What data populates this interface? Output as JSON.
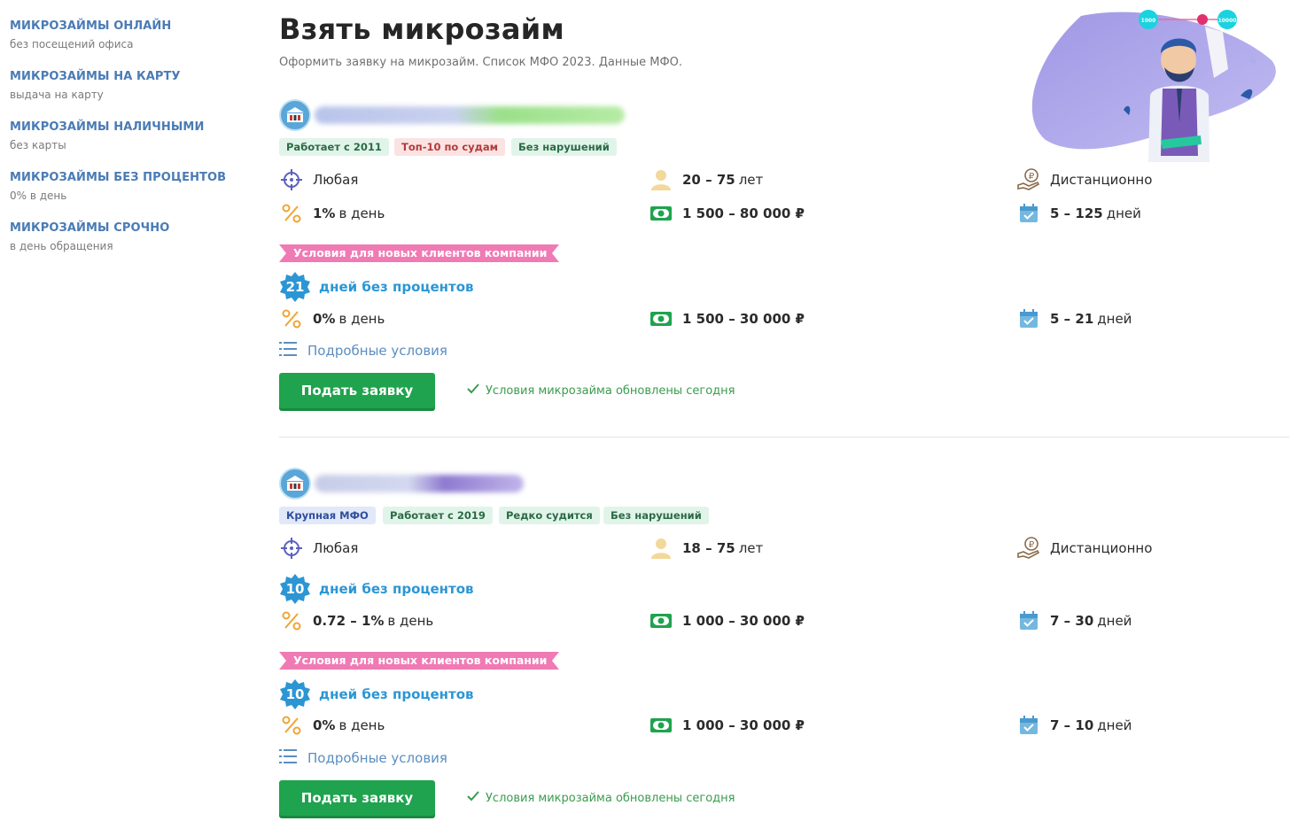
{
  "sidebar": {
    "items": [
      {
        "title": "МИКРОЗАЙМЫ ОНЛАЙН",
        "sub": "без посещений офиса"
      },
      {
        "title": "МИКРОЗАЙМЫ НА КАРТУ",
        "sub": "выдача на карту"
      },
      {
        "title": "МИКРОЗАЙМЫ НАЛИЧНЫМИ",
        "sub": "без карты"
      },
      {
        "title": "МИКРОЗАЙМЫ БЕЗ ПРОЦЕНТОВ",
        "sub": "0% в день"
      },
      {
        "title": "МИКРОЗАЙМЫ СРОЧНО",
        "sub": "в день обращения"
      }
    ]
  },
  "header": {
    "title": "Взять микрозайм",
    "subtitle": "Оформить заявку на микрозайм. Список МФО 2023. Данные МФО."
  },
  "illustration": {
    "coin_labels": [
      "1000",
      "10000"
    ]
  },
  "offers": [
    {
      "badges": [
        "Работает с 2011",
        "Топ-10 по судам",
        "Без нарушений"
      ],
      "history": "Любая",
      "age_value": "20 – 75",
      "age_unit": "лет",
      "method": "Дистанционно",
      "rate_value": "1%",
      "rate_unit": "в день",
      "amount": "1 500 – 80 000 ₽",
      "term_value": "5 – 125",
      "term_unit": "дней",
      "promo_label": "Условия для новых клиентов компании",
      "promo_days": "21",
      "promo_days_label": "дней без процентов",
      "promo_rate_value": "0%",
      "promo_rate_unit": "в день",
      "promo_amount": "1 500 – 30 000 ₽",
      "promo_term_value": "5 – 21",
      "promo_term_unit": "дней",
      "details_label": "Подробные условия",
      "apply_label": "Подать заявку",
      "updated_label": "Условия микрозайма обновлены сегодня"
    },
    {
      "badges": [
        "Крупная МФО",
        "Работает с 2019",
        "Редко судится",
        "Без нарушений"
      ],
      "history": "Любая",
      "age_value": "18 – 75",
      "age_unit": "лет",
      "method": "Дистанционно",
      "free_days": "10",
      "free_days_label": "дней без процентов",
      "rate_value": "0.72 – 1%",
      "rate_unit": "в день",
      "amount": "1 000 – 30 000 ₽",
      "term_value": "7 – 30",
      "term_unit": "дней",
      "promo_label": "Условия для новых клиентов компании",
      "promo_days": "10",
      "promo_days_label": "дней без процентов",
      "promo_rate_value": "0%",
      "promo_rate_unit": "в день",
      "promo_amount": "1 000 – 30 000 ₽",
      "promo_term_value": "7 – 10",
      "promo_term_unit": "дней",
      "details_label": "Подробные условия",
      "apply_label": "Подать заявку",
      "updated_label": "Условия микрозайма обновлены сегодня"
    }
  ],
  "colors": {
    "sidebar_link": "#4a7bb5",
    "accent_green": "#1fa34e",
    "free_days_blue": "#2c96d4",
    "promo_pink": "#f07ab4"
  }
}
